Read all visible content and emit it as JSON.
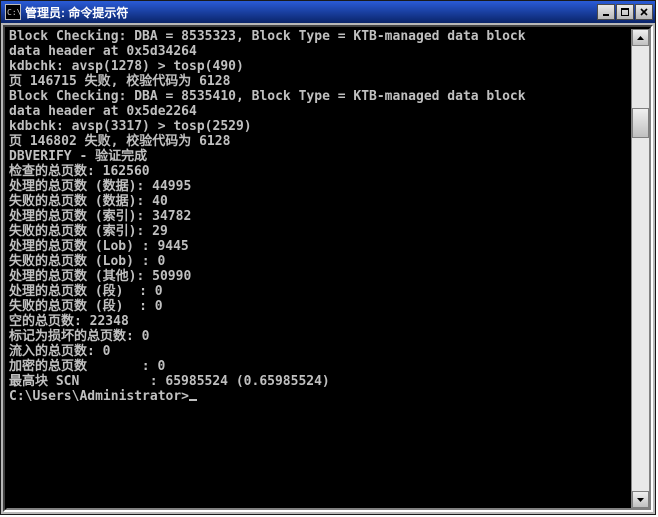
{
  "window": {
    "icon_text": "C:\\",
    "title": "管理员: 命令提示符"
  },
  "terminal": {
    "lines": [
      "Block Checking: DBA = 8535323, Block Type = KTB-managed data block",
      "data header at 0x5d34264",
      "kdbchk: avsp(1278) > tosp(490)",
      "页 146715 失败, 校验代码为 6128",
      "Block Checking: DBA = 8535410, Block Type = KTB-managed data block",
      "data header at 0x5de2264",
      "kdbchk: avsp(3317) > tosp(2529)",
      "页 146802 失败, 校验代码为 6128",
      "",
      "",
      "DBVERIFY - 验证完成",
      "",
      "检查的总页数: 162560",
      "处理的总页数 (数据): 44995",
      "失败的总页数 (数据): 40",
      "处理的总页数 (索引): 34782",
      "失败的总页数 (索引): 29",
      "处理的总页数 (Lob) : 9445",
      "失败的总页数 (Lob) : 0",
      "处理的总页数 (其他): 50990",
      "处理的总页数 (段)  : 0",
      "失败的总页数 (段)  : 0",
      "空的总页数: 22348",
      "标记为损坏的总页数: 0",
      "流入的总页数: 0",
      "加密的总页数       : 0",
      "最高块 SCN         : 65985524 (0.65985524)",
      "",
      "C:\\Users\\Administrator>"
    ]
  }
}
